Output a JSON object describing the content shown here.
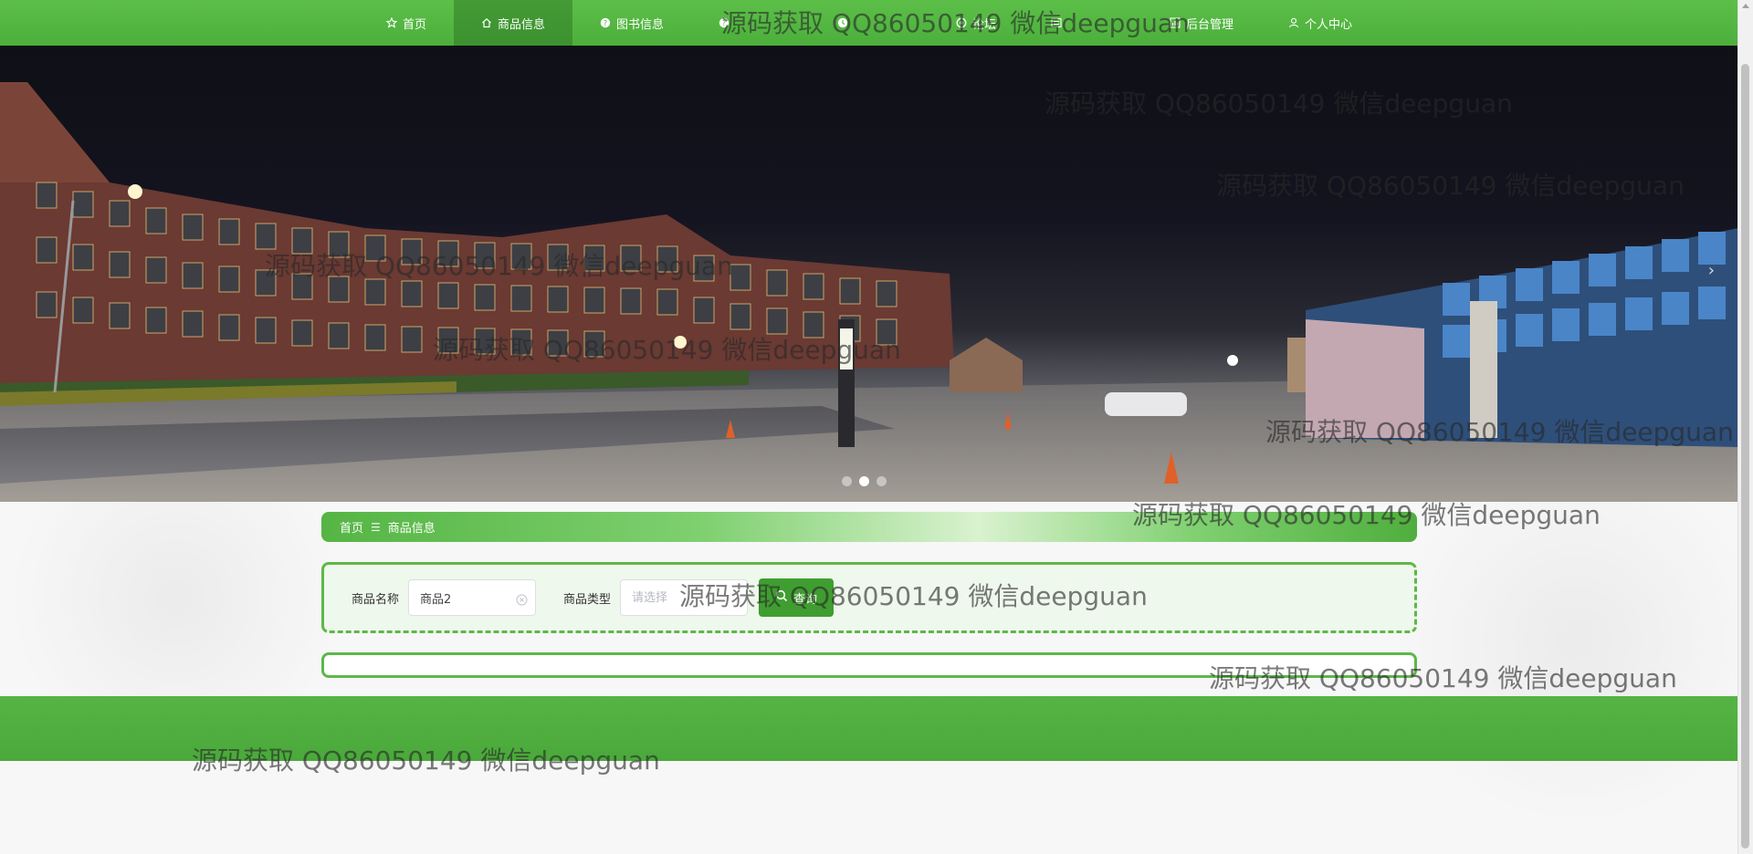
{
  "nav": {
    "items": [
      {
        "label": "首页",
        "icon": "star-icon",
        "active": false
      },
      {
        "label": "商品信息",
        "icon": "home-icon",
        "active": true
      },
      {
        "label": "图书信息",
        "icon": "question-circle-icon",
        "active": false
      },
      {
        "label": "",
        "icon": "question-circle-icon",
        "active": false
      },
      {
        "label": "",
        "icon": "clock-icon",
        "active": false
      },
      {
        "label": "论坛",
        "icon": "forum-icon",
        "active": false
      },
      {
        "label": "",
        "icon": "list-icon",
        "active": false
      },
      {
        "label": "后台管理",
        "icon": "chart-icon",
        "active": false
      },
      {
        "label": "个人中心",
        "icon": "user-icon",
        "active": false
      }
    ]
  },
  "banner": {
    "slides": 3,
    "active_slide": 2,
    "next_icon": "chevron-right-icon"
  },
  "breadcrumb": {
    "home": "首页",
    "separator": "☰",
    "current": "商品信息"
  },
  "search": {
    "name_label": "商品名称",
    "name_value": "商品2",
    "type_label": "商品类型",
    "type_placeholder": "请选择",
    "button_label": "查询",
    "button_icon": "search-icon"
  },
  "watermark": {
    "text": "源码获取 QQ86050149 微信deepguan"
  },
  "colors": {
    "primary": "#4caf3c",
    "active_nav": "#3d8a2e",
    "button": "#3f9e30"
  }
}
